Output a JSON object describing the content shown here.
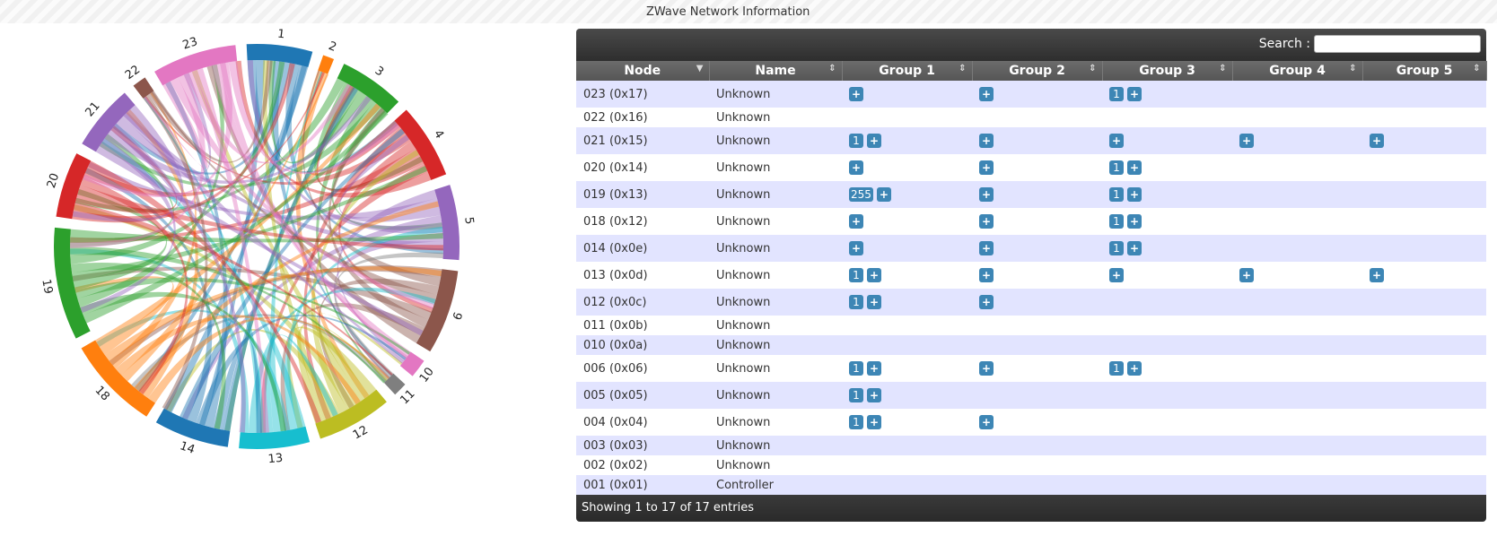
{
  "title": "ZWave Network Information",
  "search": {
    "label": "Search :",
    "value": ""
  },
  "columns": [
    "Node",
    "Name",
    "Group 1",
    "Group 2",
    "Group 3",
    "Group 4",
    "Group 5"
  ],
  "footer": "Showing 1 to 17 of 17 entries",
  "rows": [
    {
      "node": "023 (0x17)",
      "name": "Unknown",
      "groups": [
        [
          "+"
        ],
        [
          "+"
        ],
        [
          "1",
          "+"
        ],
        [],
        []
      ],
      "h": 30
    },
    {
      "node": "022 (0x16)",
      "name": "Unknown",
      "groups": [
        [],
        [],
        [],
        [],
        []
      ],
      "h": 22
    },
    {
      "node": "021 (0x15)",
      "name": "Unknown",
      "groups": [
        [
          "1",
          "+"
        ],
        [
          "+"
        ],
        [
          "+"
        ],
        [
          "+"
        ],
        [
          "+"
        ]
      ],
      "h": 30
    },
    {
      "node": "020 (0x14)",
      "name": "Unknown",
      "groups": [
        [
          "+"
        ],
        [
          "+"
        ],
        [
          "1",
          "+"
        ],
        [],
        []
      ],
      "h": 30
    },
    {
      "node": "019 (0x13)",
      "name": "Unknown",
      "groups": [
        [
          "255",
          "+"
        ],
        [
          "+"
        ],
        [
          "1",
          "+"
        ],
        [],
        []
      ],
      "h": 30
    },
    {
      "node": "018 (0x12)",
      "name": "Unknown",
      "groups": [
        [
          "+"
        ],
        [
          "+"
        ],
        [
          "1",
          "+"
        ],
        [],
        []
      ],
      "h": 30
    },
    {
      "node": "014 (0x0e)",
      "name": "Unknown",
      "groups": [
        [
          "+"
        ],
        [
          "+"
        ],
        [
          "1",
          "+"
        ],
        [],
        []
      ],
      "h": 30
    },
    {
      "node": "013 (0x0d)",
      "name": "Unknown",
      "groups": [
        [
          "1",
          "+"
        ],
        [
          "+"
        ],
        [
          "+"
        ],
        [
          "+"
        ],
        [
          "+"
        ]
      ],
      "h": 30
    },
    {
      "node": "012 (0x0c)",
      "name": "Unknown",
      "groups": [
        [
          "1",
          "+"
        ],
        [
          "+"
        ],
        [],
        [],
        []
      ],
      "h": 30
    },
    {
      "node": "011 (0x0b)",
      "name": "Unknown",
      "groups": [
        [],
        [],
        [],
        [],
        []
      ],
      "h": 22
    },
    {
      "node": "010 (0x0a)",
      "name": "Unknown",
      "groups": [
        [],
        [],
        [],
        [],
        []
      ],
      "h": 22
    },
    {
      "node": "006 (0x06)",
      "name": "Unknown",
      "groups": [
        [
          "1",
          "+"
        ],
        [
          "+"
        ],
        [
          "1",
          "+"
        ],
        [],
        []
      ],
      "h": 30
    },
    {
      "node": "005 (0x05)",
      "name": "Unknown",
      "groups": [
        [
          "1",
          "+"
        ],
        [],
        [],
        [],
        []
      ],
      "h": 30
    },
    {
      "node": "004 (0x04)",
      "name": "Unknown",
      "groups": [
        [
          "1",
          "+"
        ],
        [
          "+"
        ],
        [],
        [],
        []
      ],
      "h": 30
    },
    {
      "node": "003 (0x03)",
      "name": "Unknown",
      "groups": [
        [],
        [],
        [],
        [],
        []
      ],
      "h": 22
    },
    {
      "node": "002 (0x02)",
      "name": "Unknown",
      "groups": [
        [],
        [],
        [],
        [],
        []
      ],
      "h": 22
    },
    {
      "node": "001 (0x01)",
      "name": "Controller",
      "groups": [
        [],
        [],
        [],
        [],
        []
      ],
      "h": 22
    }
  ],
  "chord": {
    "groups": [
      {
        "label": "1",
        "color": "#1f77b4",
        "weight": 7
      },
      {
        "label": "2",
        "color": "#ff7f0e",
        "weight": 1.2
      },
      {
        "label": "3",
        "color": "#2ca02c",
        "weight": 7
      },
      {
        "label": "4",
        "color": "#d62728",
        "weight": 8
      },
      {
        "label": "5",
        "color": "#9467bd",
        "weight": 8
      },
      {
        "label": "6",
        "color": "#8c564b",
        "weight": 9
      },
      {
        "label": "10",
        "color": "#e377c2",
        "weight": 2
      },
      {
        "label": "11",
        "color": "#7f7f7f",
        "weight": 1.5
      },
      {
        "label": "12",
        "color": "#bcbd22",
        "weight": 8
      },
      {
        "label": "13",
        "color": "#17becf",
        "weight": 7.5
      },
      {
        "label": "14",
        "color": "#1f77b4",
        "weight": 8
      },
      {
        "label": "18",
        "color": "#ff7f0e",
        "weight": 10
      },
      {
        "label": "19",
        "color": "#2ca02c",
        "weight": 12
      },
      {
        "label": "20",
        "color": "#d62728",
        "weight": 7
      },
      {
        "label": "21",
        "color": "#9467bd",
        "weight": 7
      },
      {
        "label": "22",
        "color": "#8c564b",
        "weight": 1.5
      },
      {
        "label": "23",
        "color": "#e377c2",
        "weight": 9
      }
    ]
  }
}
